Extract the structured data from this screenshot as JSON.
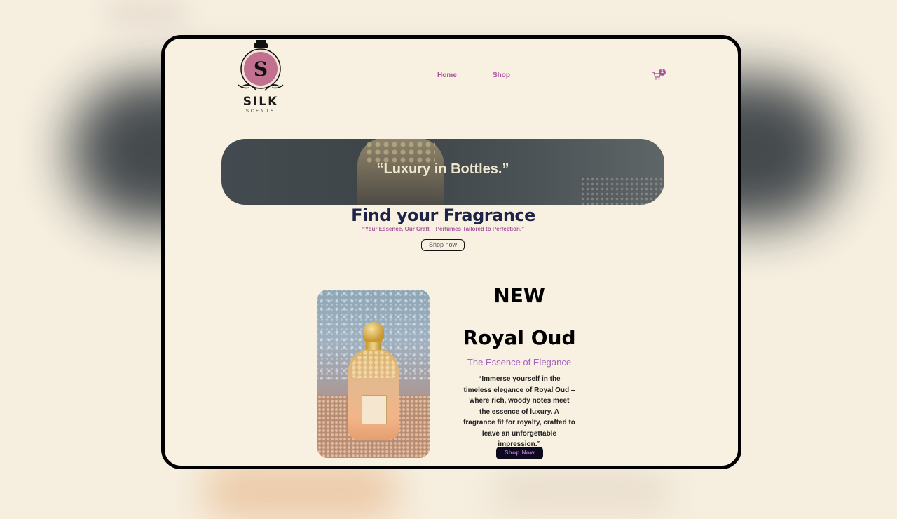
{
  "brand": {
    "name": "SILK",
    "sub": "SCENTS",
    "monogram": "S"
  },
  "nav": {
    "items": [
      {
        "label": "Home"
      },
      {
        "label": "Shop"
      }
    ],
    "cart_count": "1"
  },
  "hero": {
    "quote": "“Luxury in Bottles.”"
  },
  "intro": {
    "title": "Find your Fragrance",
    "subtitle": "“Your Essence, Our Craft – Perfumes Tailored to Perfection.”",
    "cta": "Shop now"
  },
  "product": {
    "badge": "NEW",
    "name": "Royal Oud",
    "tagline": "The Essence of Elegance",
    "description": "“Immerse yourself in the timeless elegance of Royal Oud – where rich, woody notes meet the essence of luxury. A fragrance fit for royalty, crafted to leave an unforgettable impression.”",
    "cta": "Shop Now"
  },
  "colors": {
    "accent": "#a7549b",
    "heading": "#1d2448",
    "tagline": "#a365c4",
    "background": "#f8f0e0",
    "button_dark": "#0d0a1e"
  }
}
